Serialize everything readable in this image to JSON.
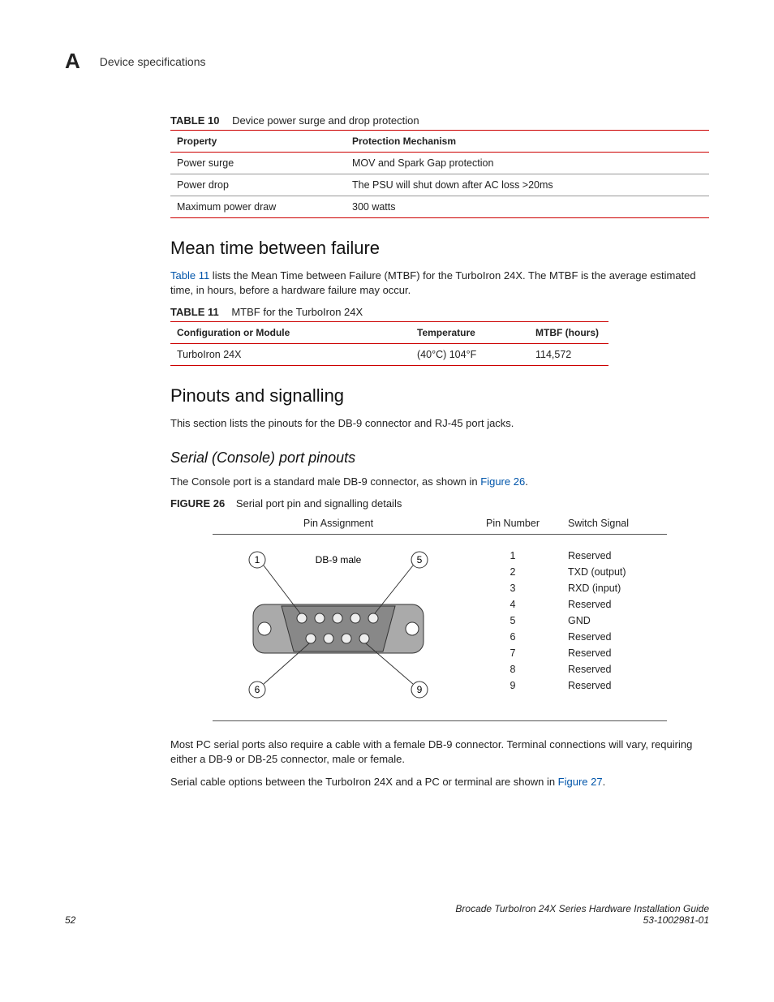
{
  "header": {
    "appendix_letter": "A",
    "title": "Device specifications"
  },
  "table10": {
    "label": "TABLE 10",
    "caption": "Device power surge and drop protection",
    "col1": "Property",
    "col2": "Protection Mechanism",
    "rows": [
      {
        "prop": "Power surge",
        "val": "MOV and Spark Gap protection"
      },
      {
        "prop": "Power drop",
        "val": "The PSU will shut down after AC loss >20ms"
      },
      {
        "prop": "Maximum power draw",
        "val": "300 watts"
      }
    ]
  },
  "mtbf": {
    "heading": "Mean time between failure",
    "para_prefix": "Table 11",
    "para_rest": " lists the Mean Time between Failure (MTBF) for the TurboIron 24X. The MTBF is the average estimated time, in hours, before a hardware failure may occur."
  },
  "table11": {
    "label": "TABLE 11",
    "caption": "MTBF for the TurboIron 24X",
    "col1": "Configuration or Module",
    "col2": "Temperature",
    "col3": "MTBF (hours)",
    "row": {
      "c1": "TurboIron 24X",
      "c2": "(40°C) 104°F",
      "c3": "114,572"
    }
  },
  "pinouts": {
    "heading": "Pinouts and signalling",
    "para": "This section lists the pinouts for the DB-9 connector and RJ-45 port jacks."
  },
  "serial": {
    "heading": "Serial (Console) port pinouts",
    "para_prefix": "The Console port is a standard male DB-9 connector, as shown in ",
    "para_link": "Figure 26",
    "para_suffix": "."
  },
  "figure26": {
    "label": "FIGURE 26",
    "caption": "Serial port pin and signalling details",
    "h1": "Pin Assignment",
    "h2": "Pin Number",
    "h3": "Switch Signal",
    "diagram_label": "DB-9 male",
    "corners": {
      "tl": "1",
      "tr": "5",
      "bl": "6",
      "br": "9"
    },
    "pins": [
      {
        "n": "1",
        "sig": "Reserved"
      },
      {
        "n": "2",
        "sig": "TXD (output)"
      },
      {
        "n": "3",
        "sig": "RXD (input)"
      },
      {
        "n": "4",
        "sig": "Reserved"
      },
      {
        "n": "5",
        "sig": "GND"
      },
      {
        "n": "6",
        "sig": "Reserved"
      },
      {
        "n": "7",
        "sig": "Reserved"
      },
      {
        "n": "8",
        "sig": "Reserved"
      },
      {
        "n": "9",
        "sig": "Reserved"
      }
    ]
  },
  "post_fig": {
    "p1": "Most PC serial ports also require a cable with a female DB-9 connector. Terminal connections will vary, requiring either a DB-9 or DB-25 connector, male or female.",
    "p2_prefix": "Serial cable options between the TurboIron 24X and a PC or terminal are shown in ",
    "p2_link": "Figure 27",
    "p2_suffix": "."
  },
  "footer": {
    "page": "52",
    "guide": "Brocade TurboIron 24X Series Hardware Installation Guide",
    "docnum": "53-1002981-01"
  }
}
